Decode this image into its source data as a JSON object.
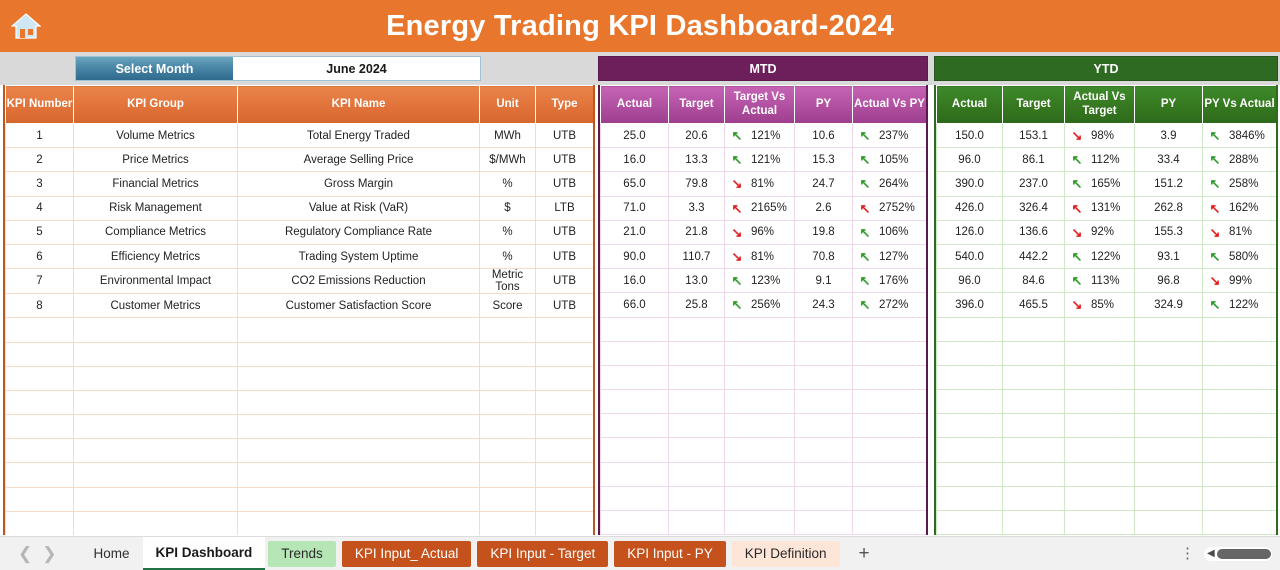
{
  "header": {
    "title": "Energy Trading KPI Dashboard-2024",
    "home_icon": "home-icon",
    "bg_color": "#e8762d"
  },
  "controls": {
    "select_month_label": "Select Month",
    "select_month_value": "June 2024"
  },
  "bands": {
    "mtd": {
      "label": "MTD",
      "color": "#6d1f5c"
    },
    "ytd": {
      "label": "YTD",
      "color": "#2f6a22"
    }
  },
  "left_table": {
    "headers": [
      "KPI Number",
      "KPI Group",
      "KPI Name",
      "Unit",
      "Type"
    ],
    "rows": [
      {
        "num": "1",
        "group": "Volume Metrics",
        "name": "Total Energy Traded",
        "unit": "MWh",
        "type": "UTB"
      },
      {
        "num": "2",
        "group": "Price Metrics",
        "name": "Average Selling Price",
        "unit": "$/MWh",
        "type": "UTB"
      },
      {
        "num": "3",
        "group": "Financial Metrics",
        "name": "Gross Margin",
        "unit": "%",
        "type": "UTB"
      },
      {
        "num": "4",
        "group": "Risk Management",
        "name": "Value at Risk (VaR)",
        "unit": "$",
        "type": "LTB"
      },
      {
        "num": "5",
        "group": "Compliance Metrics",
        "name": "Regulatory Compliance Rate",
        "unit": "%",
        "type": "UTB"
      },
      {
        "num": "6",
        "group": "Efficiency Metrics",
        "name": "Trading System Uptime",
        "unit": "%",
        "type": "UTB"
      },
      {
        "num": "7",
        "group": "Environmental Impact",
        "name": "CO2 Emissions Reduction",
        "unit": "Metric Tons",
        "type": "UTB"
      },
      {
        "num": "8",
        "group": "Customer Metrics",
        "name": "Customer Satisfaction Score",
        "unit": "Score",
        "type": "UTB"
      }
    ]
  },
  "mtd_table": {
    "headers": [
      "Actual",
      "Target",
      "Target Vs Actual",
      "PY",
      "Actual Vs PY"
    ],
    "rows": [
      {
        "actual": "25.0",
        "target": "20.6",
        "tva_pct": "121%",
        "tva_dir": "up",
        "py": "10.6",
        "avp_pct": "237%",
        "avp_dir": "up"
      },
      {
        "actual": "16.0",
        "target": "13.3",
        "tva_pct": "121%",
        "tva_dir": "up",
        "py": "15.3",
        "avp_pct": "105%",
        "avp_dir": "up"
      },
      {
        "actual": "65.0",
        "target": "79.8",
        "tva_pct": "81%",
        "tva_dir": "down",
        "py": "24.7",
        "avp_pct": "264%",
        "avp_dir": "up"
      },
      {
        "actual": "71.0",
        "target": "3.3",
        "tva_pct": "2165%",
        "tva_dir": "upred",
        "py": "2.6",
        "avp_pct": "2752%",
        "avp_dir": "upred"
      },
      {
        "actual": "21.0",
        "target": "21.8",
        "tva_pct": "96%",
        "tva_dir": "down",
        "py": "19.8",
        "avp_pct": "106%",
        "avp_dir": "up"
      },
      {
        "actual": "90.0",
        "target": "110.7",
        "tva_pct": "81%",
        "tva_dir": "down",
        "py": "70.8",
        "avp_pct": "127%",
        "avp_dir": "up"
      },
      {
        "actual": "16.0",
        "target": "13.0",
        "tva_pct": "123%",
        "tva_dir": "up",
        "py": "9.1",
        "avp_pct": "176%",
        "avp_dir": "up"
      },
      {
        "actual": "66.0",
        "target": "25.8",
        "tva_pct": "256%",
        "tva_dir": "up",
        "py": "24.3",
        "avp_pct": "272%",
        "avp_dir": "up"
      }
    ]
  },
  "ytd_table": {
    "headers": [
      "Actual",
      "Target",
      "Actual Vs Target",
      "PY",
      "PY Vs Actual"
    ],
    "rows": [
      {
        "actual": "150.0",
        "target": "153.1",
        "avt_pct": "98%",
        "avt_dir": "down",
        "py": "3.9",
        "pva_pct": "3846%",
        "pva_dir": "up"
      },
      {
        "actual": "96.0",
        "target": "86.1",
        "avt_pct": "112%",
        "avt_dir": "up",
        "py": "33.4",
        "pva_pct": "288%",
        "pva_dir": "up"
      },
      {
        "actual": "390.0",
        "target": "237.0",
        "avt_pct": "165%",
        "avt_dir": "up",
        "py": "151.2",
        "pva_pct": "258%",
        "pva_dir": "up"
      },
      {
        "actual": "426.0",
        "target": "326.4",
        "avt_pct": "131%",
        "avt_dir": "upred",
        "py": "262.8",
        "pva_pct": "162%",
        "pva_dir": "upred"
      },
      {
        "actual": "126.0",
        "target": "136.6",
        "avt_pct": "92%",
        "avt_dir": "down",
        "py": "155.3",
        "pva_pct": "81%",
        "pva_dir": "down"
      },
      {
        "actual": "540.0",
        "target": "442.2",
        "avt_pct": "122%",
        "avt_dir": "up",
        "py": "93.1",
        "pva_pct": "580%",
        "pva_dir": "up"
      },
      {
        "actual": "96.0",
        "target": "84.6",
        "avt_pct": "113%",
        "avt_dir": "up",
        "py": "96.8",
        "pva_pct": "99%",
        "pva_dir": "down"
      },
      {
        "actual": "396.0",
        "target": "465.5",
        "avt_pct": "85%",
        "avt_dir": "down",
        "py": "324.9",
        "pva_pct": "122%",
        "pva_dir": "up"
      }
    ]
  },
  "tabbar": {
    "prev_icon": "chevron-left-icon",
    "next_icon": "chevron-right-icon",
    "add_label": "+",
    "kebab_icon": "more-options-icon",
    "scroll_icon": "scroll-left-icon",
    "tabs": [
      {
        "label": "Home",
        "style": "plain"
      },
      {
        "label": "KPI Dashboard",
        "style": "active"
      },
      {
        "label": "Trends",
        "style": "green"
      },
      {
        "label": "KPI Input_ Actual",
        "style": "orange"
      },
      {
        "label": "KPI Input - Target",
        "style": "orange"
      },
      {
        "label": "KPI Input - PY",
        "style": "orange"
      },
      {
        "label": "KPI Definition",
        "style": "peach"
      }
    ]
  }
}
